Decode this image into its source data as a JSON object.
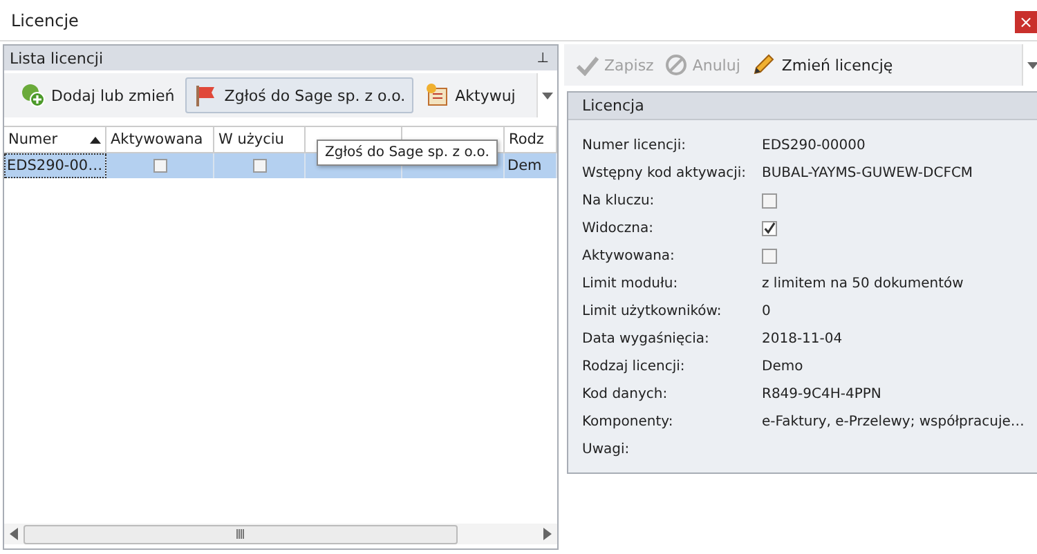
{
  "window": {
    "title": "Licencje",
    "close": "×"
  },
  "left_panel": {
    "title": "Lista licencji",
    "pin": "⊥",
    "toolbar": [
      {
        "label": "Dodaj lub zmień",
        "kind": "add",
        "selected": false
      },
      {
        "label": "Zgłoś do Sage sp. z o.o.",
        "kind": "flag",
        "selected": true
      },
      {
        "label": "Aktywuj",
        "kind": "activate",
        "selected": false
      }
    ],
    "table": {
      "columns": [
        {
          "label": "Numer",
          "sorted": true
        },
        {
          "label": "Aktywowana",
          "sorted": false
        },
        {
          "label": "W użyciu",
          "sorted": false
        },
        {
          "sorted": false
        },
        {
          "sorted": false
        },
        {
          "label": "Rodz",
          "sorted": false
        }
      ],
      "rows": [
        {
          "selected": true,
          "cells": [
            {
              "kind": "text",
              "text": "EDS290-00…"
            },
            {
              "kind": "check",
              "checked": false
            },
            {
              "kind": "check",
              "checked": false
            },
            {
              "kind": "empty"
            },
            {
              "kind": "empty"
            },
            {
              "kind": "text",
              "text": "Dem"
            }
          ]
        }
      ]
    },
    "tooltip": "Zgłoś do Sage sp. z o.o."
  },
  "right_toolbar": [
    {
      "label": "Zapisz",
      "kind": "save",
      "disabled": true
    },
    {
      "label": "Anuluj",
      "kind": "cancel",
      "disabled": true
    },
    {
      "label": "Zmień licencję",
      "kind": "edit",
      "disabled": false
    }
  ],
  "details": {
    "title": "Licencja",
    "fields": [
      {
        "label": "Numer licencji:",
        "kind": "text",
        "value": "EDS290-00000"
      },
      {
        "label": "Wstępny kod aktywacji:",
        "kind": "text",
        "value": "BUBAL-YAYMS-GUWEW-DCFCM"
      },
      {
        "label": "Na kluczu:",
        "kind": "check",
        "checked": false
      },
      {
        "label": "Widoczna:",
        "kind": "check",
        "checked": true
      },
      {
        "label": "Aktywowana:",
        "kind": "check",
        "checked": false
      },
      {
        "label": "Limit modułu:",
        "kind": "text",
        "value": "z limitem na 50 dokumentów"
      },
      {
        "label": "Limit użytkowników:",
        "kind": "text",
        "value": "0"
      },
      {
        "label": "Data wygaśnięcia:",
        "kind": "text",
        "value": "2018-11-04"
      },
      {
        "label": "Rodzaj licencji:",
        "kind": "text",
        "value": "Demo"
      },
      {
        "label": "Kod danych:",
        "kind": "text",
        "value": "R849-9C4H-4PPN"
      },
      {
        "label": "Komponenty:",
        "kind": "text",
        "value": "e-Faktury, e-Przelewy; współpracuje…"
      },
      {
        "label": "Uwagi:",
        "kind": "text"
      }
    ]
  }
}
